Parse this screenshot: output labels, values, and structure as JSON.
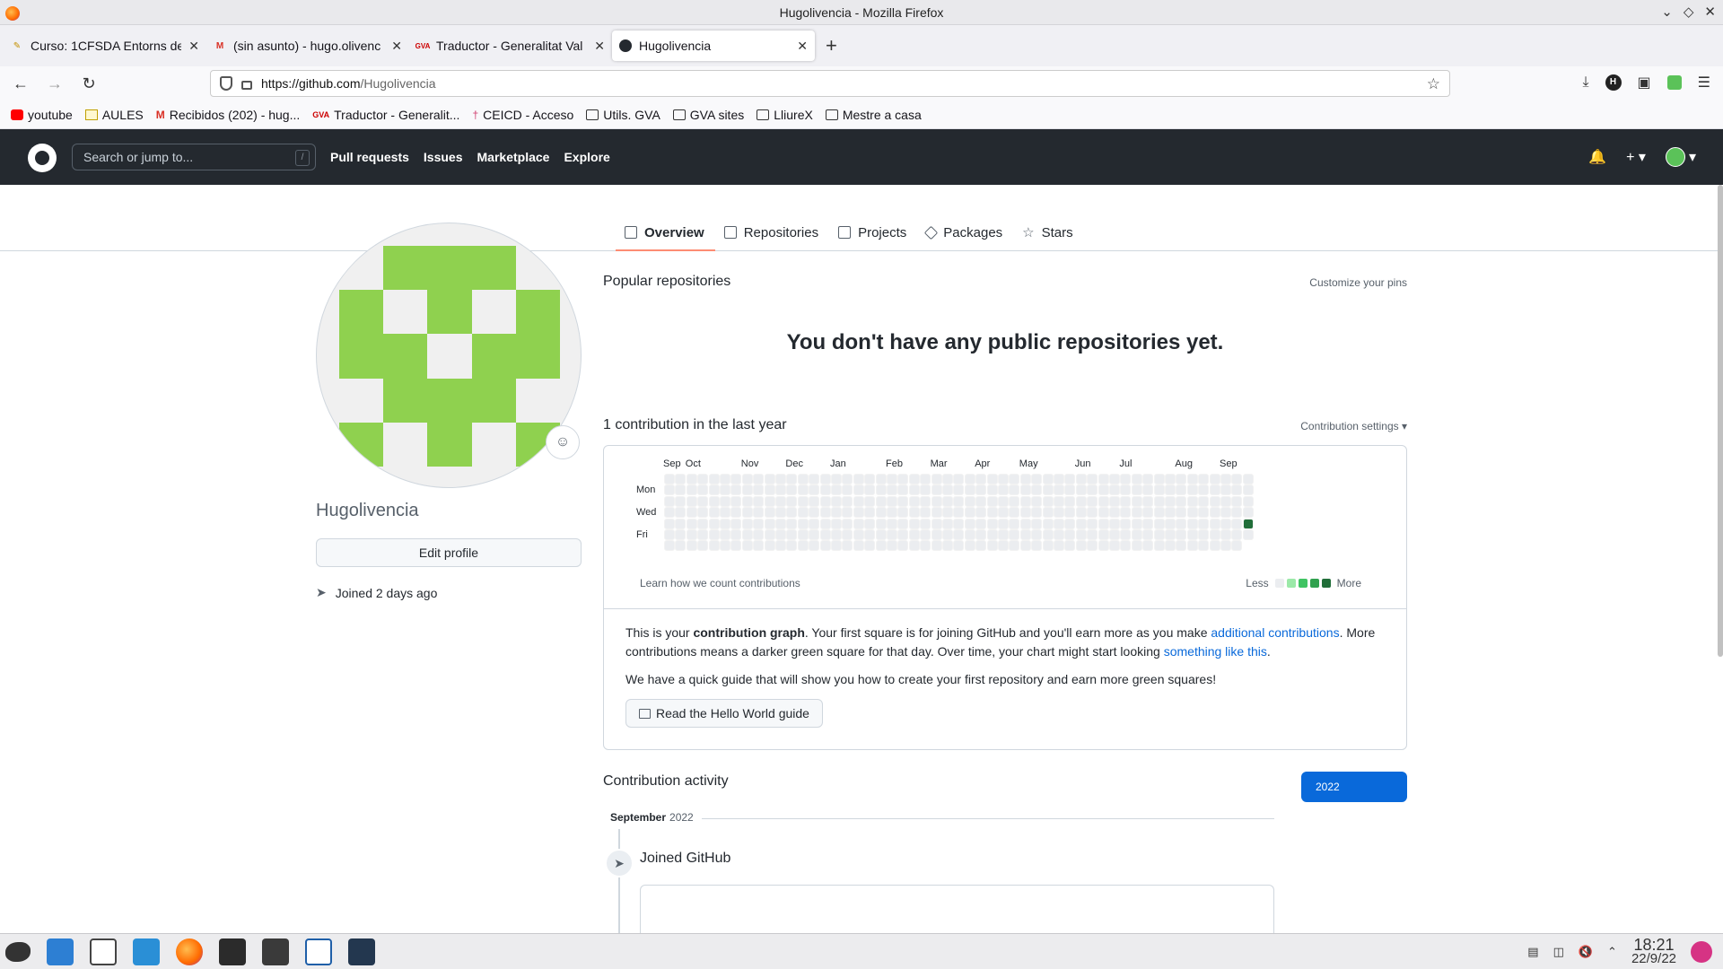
{
  "window": {
    "title": "Hugolivencia - Mozilla Firefox"
  },
  "tabs": [
    {
      "label": "Curso: 1CFSDA Entorns de",
      "icon": "moodle-icon"
    },
    {
      "label": "(sin asunto) - hugo.olivenc",
      "icon": "gmail-icon"
    },
    {
      "label": "Traductor - Generalitat Val",
      "icon": "gva-icon"
    },
    {
      "label": "Hugolivencia",
      "icon": "github-icon",
      "active": true
    }
  ],
  "urlbar": {
    "host": "https://github.com",
    "path": "/Hugolivencia"
  },
  "bookmarks": [
    {
      "label": "youtube",
      "icon": "youtube-icon"
    },
    {
      "label": "AULES",
      "icon": "doc-icon"
    },
    {
      "label": "Recibidos (202) - hug...",
      "icon": "gmail-icon"
    },
    {
      "label": "Traductor - Generalit...",
      "icon": "gva-icon"
    },
    {
      "label": "CEICD - Acceso",
      "icon": "ceicd-icon"
    },
    {
      "label": "Utils. GVA",
      "icon": "folder-icon"
    },
    {
      "label": "GVA sites",
      "icon": "folder-icon"
    },
    {
      "label": "LliureX",
      "icon": "folder-icon"
    },
    {
      "label": "Mestre a casa",
      "icon": "folder-icon"
    }
  ],
  "gh": {
    "search_placeholder": "Search or jump to...",
    "search_key": "/",
    "nav": [
      "Pull requests",
      "Issues",
      "Marketplace",
      "Explore"
    ]
  },
  "profile_tabs": [
    {
      "label": "Overview",
      "active": true
    },
    {
      "label": "Repositories"
    },
    {
      "label": "Projects"
    },
    {
      "label": "Packages"
    },
    {
      "label": "Stars"
    }
  ],
  "profile": {
    "username": "Hugolivencia",
    "edit_label": "Edit profile",
    "joined": "Joined 2 days ago",
    "avatar_color": "#8fd14f"
  },
  "popular": {
    "title": "Popular repositories",
    "customize": "Customize your pins",
    "empty": "You don't have any public repositories yet."
  },
  "contributions": {
    "title": "1 contribution in the last year",
    "settings": "Contribution settings ▾",
    "months": [
      "Sep",
      "Oct",
      "Nov",
      "Dec",
      "Jan",
      "Feb",
      "Mar",
      "Apr",
      "May",
      "Jun",
      "Jul",
      "Aug",
      "Sep"
    ],
    "days": [
      "Mon",
      "Wed",
      "Fri"
    ],
    "learn": "Learn how we count contributions",
    "legend_less": "Less",
    "legend_more": "More",
    "legend_colors": [
      "#ebedf0",
      "#9be9a8",
      "#40c463",
      "#30a14e",
      "#216e39"
    ],
    "active_color": "#216e39",
    "active_contribution": {
      "week": 52,
      "day": "Thu",
      "count": 1
    },
    "weeks": 53,
    "explain_1": "This is your ",
    "explain_bold": "contribution graph",
    "explain_2": ". Your first square is for joining GitHub and you'll earn more as you make ",
    "explain_link1": "additional contributions",
    "explain_3": ". More contributions means a darker green square for that day. Over time, your chart might start looking ",
    "explain_link2": "something like this",
    "explain_4": ".",
    "guide_text": "We have a quick guide that will show you how to create your first repository and earn more green squares!",
    "guide_button": "Read the Hello World guide"
  },
  "activity": {
    "title": "Contribution activity",
    "year": "2022",
    "month": "September",
    "month_year": "2022",
    "event": "Joined GitHub"
  },
  "taskbar": {
    "time": "18:21",
    "date": "22/9/22"
  }
}
